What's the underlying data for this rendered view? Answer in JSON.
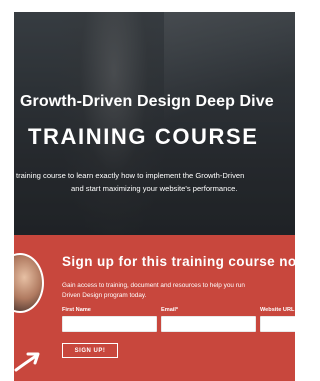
{
  "hero": {
    "headline": "Growth-Driven Design Deep Dive",
    "title": "TRAINING COURSE",
    "description_line1": "training course to learn exactly how to implement the Growth-Driven",
    "description_line2": "and start maximizing your website's performance."
  },
  "signup": {
    "title": "Sign up for this training course now",
    "description_line1": "Gain access to training, document and resources to help you run",
    "description_line2": "Driven Design program today.",
    "fields": {
      "first_name_label": "First Name",
      "email_label": "Email*",
      "website_label": "Website URL"
    },
    "button_label": "SIGN UP!"
  },
  "colors": {
    "signup_background": "#c8473d",
    "hero_text": "#ffffff"
  }
}
